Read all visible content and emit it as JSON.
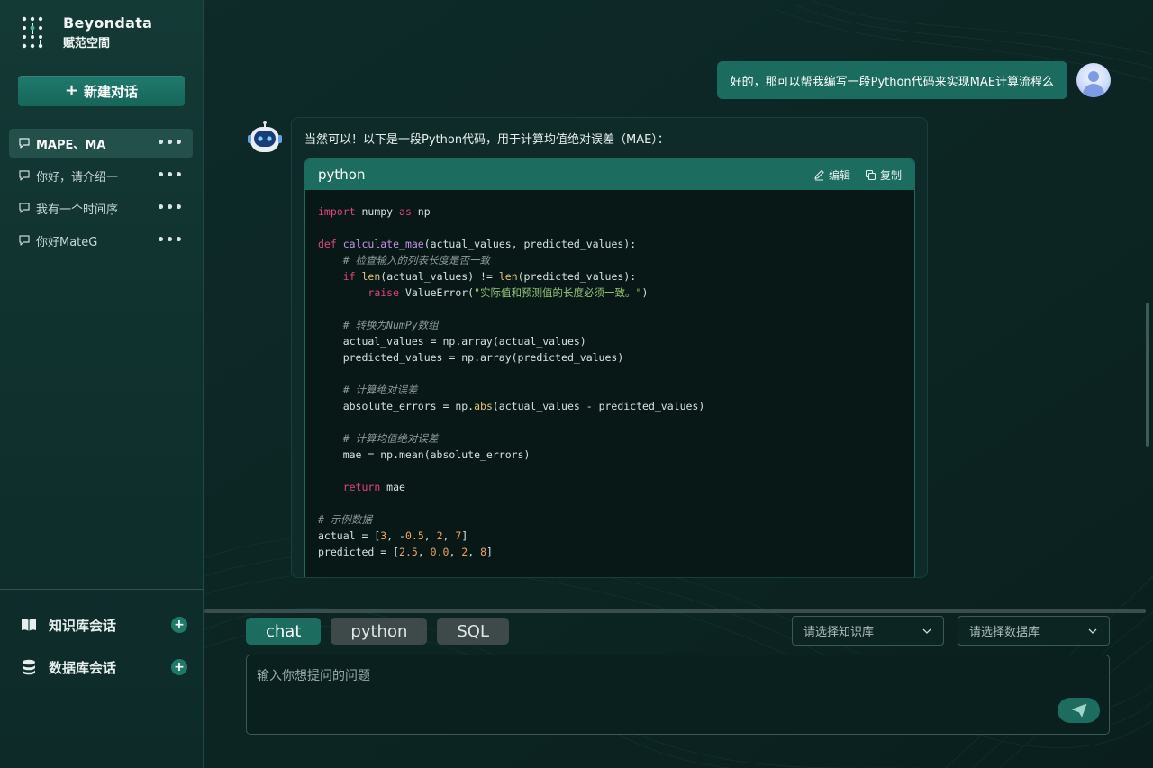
{
  "colors": {
    "accent": "#1d6c60",
    "sidebar_bg": "#143a36",
    "page_bg": "#0b2422"
  },
  "brand": {
    "name_en": "Beyondata",
    "name_cn": "赋范空間"
  },
  "sidebar": {
    "new_chat_label": "新建对话",
    "conversations": [
      {
        "label": "MAPE、MA",
        "more": "•••"
      },
      {
        "label": "你好，请介绍一",
        "more": "•••"
      },
      {
        "label": "我有一个时间序",
        "more": "•••"
      },
      {
        "label": "你好MateG",
        "more": "•••"
      }
    ],
    "knowledge_label": "知识库会话",
    "database_label": "数据库会话"
  },
  "chat": {
    "user_message": "好的，那可以帮我编写一段Python代码来实现MAE计算流程么",
    "bot_intro": "当然可以！以下是一段Python代码，用于计算均值绝对误差（MAE）：",
    "code": {
      "language": "python",
      "edit_label": "编辑",
      "copy_label": "复制",
      "lines": [
        [
          [
            "kw",
            "import"
          ],
          [
            "t",
            " numpy "
          ],
          [
            "kw",
            "as"
          ],
          [
            "t",
            " np"
          ]
        ],
        [],
        [
          [
            "kw",
            "def"
          ],
          [
            "t",
            " "
          ],
          [
            "fn",
            "calculate_mae"
          ],
          [
            "t",
            "(actual_values, predicted_values):"
          ]
        ],
        [
          [
            "t",
            "    "
          ],
          [
            "cm",
            "# 检查输入的列表长度是否一致"
          ]
        ],
        [
          [
            "t",
            "    "
          ],
          [
            "kw",
            "if"
          ],
          [
            "t",
            " "
          ],
          [
            "bi",
            "len"
          ],
          [
            "t",
            "(actual_values) != "
          ],
          [
            "bi",
            "len"
          ],
          [
            "t",
            "(predicted_values):"
          ]
        ],
        [
          [
            "t",
            "        "
          ],
          [
            "kw",
            "raise"
          ],
          [
            "t",
            " ValueError("
          ],
          [
            "st",
            "\"实际值和预测值的长度必须一致。\""
          ],
          [
            "t",
            ")"
          ]
        ],
        [],
        [
          [
            "t",
            "    "
          ],
          [
            "cm",
            "# 转换为NumPy数组"
          ]
        ],
        [
          [
            "t",
            "    actual_values = np.array(actual_values)"
          ]
        ],
        [
          [
            "t",
            "    predicted_values = np.array(predicted_values)"
          ]
        ],
        [],
        [
          [
            "t",
            "    "
          ],
          [
            "cm",
            "# 计算绝对误差"
          ]
        ],
        [
          [
            "t",
            "    absolute_errors = np."
          ],
          [
            "bi",
            "abs"
          ],
          [
            "t",
            "(actual_values - predicted_values)"
          ]
        ],
        [],
        [
          [
            "t",
            "    "
          ],
          [
            "cm",
            "# 计算均值绝对误差"
          ]
        ],
        [
          [
            "t",
            "    mae = np.mean(absolute_errors)"
          ]
        ],
        [],
        [
          [
            "t",
            "    "
          ],
          [
            "kw",
            "return"
          ],
          [
            "t",
            " mae"
          ]
        ],
        [],
        [
          [
            "cm",
            "# 示例数据"
          ]
        ],
        [
          [
            "t",
            "actual = ["
          ],
          [
            "nm",
            "3"
          ],
          [
            "t",
            ", -"
          ],
          [
            "nm",
            "0.5"
          ],
          [
            "t",
            ", "
          ],
          [
            "nm",
            "2"
          ],
          [
            "t",
            ", "
          ],
          [
            "nm",
            "7"
          ],
          [
            "t",
            "]"
          ]
        ],
        [
          [
            "t",
            "predicted = ["
          ],
          [
            "nm",
            "2.5"
          ],
          [
            "t",
            ", "
          ],
          [
            "nm",
            "0.0"
          ],
          [
            "t",
            ", "
          ],
          [
            "nm",
            "2"
          ],
          [
            "t",
            ", "
          ],
          [
            "nm",
            "8"
          ],
          [
            "t",
            "]"
          ]
        ]
      ]
    }
  },
  "composer": {
    "tabs": [
      "chat",
      "python",
      "SQL"
    ],
    "active_tab": "chat",
    "knowledge_select_placeholder": "请选择知识库",
    "database_select_placeholder": "请选择数据库",
    "input_placeholder": "输入你想提问的问题"
  }
}
